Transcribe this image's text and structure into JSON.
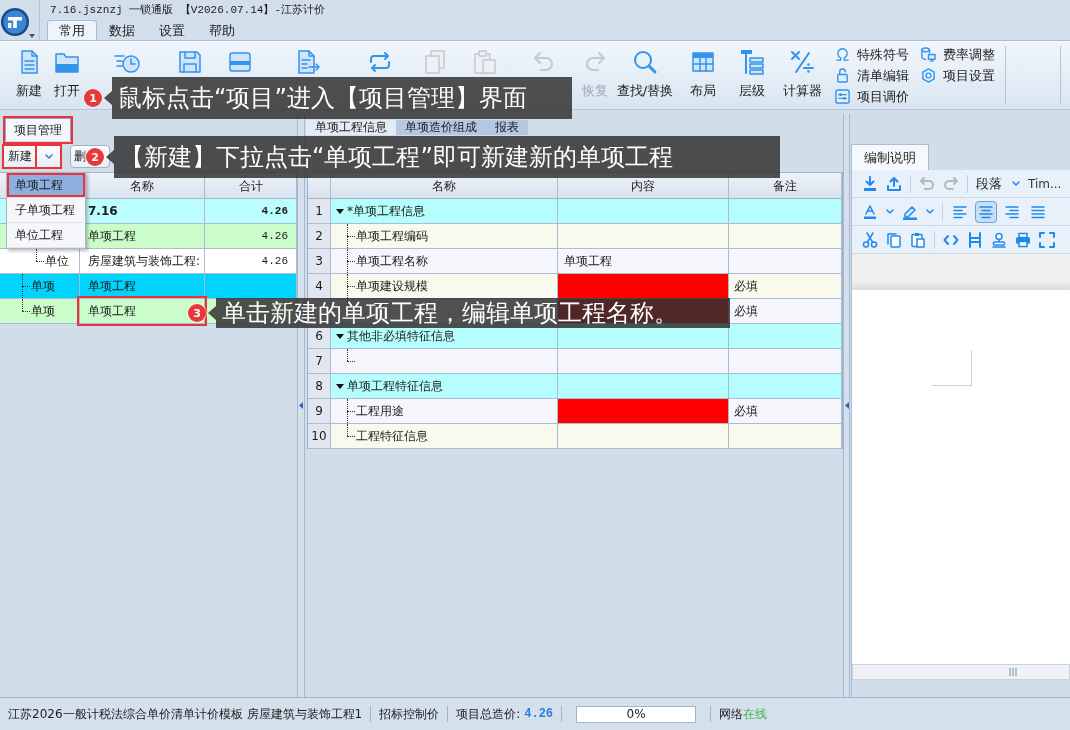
{
  "window": {
    "title": "7.16.jsznzj 一锁通版 【V2026.07.14】-江苏计价"
  },
  "menu_tabs": [
    {
      "label": "常用",
      "selected": true
    },
    {
      "label": "数据",
      "selected": false
    },
    {
      "label": "设置",
      "selected": false
    },
    {
      "label": "帮助",
      "selected": false
    }
  ],
  "ribbon": {
    "buttons": [
      {
        "label": "新建",
        "disabled": false
      },
      {
        "label": "打开",
        "disabled": false
      },
      {
        "disabled": false
      },
      {
        "disabled": false
      },
      {
        "disabled": false
      },
      {
        "disabled": false
      },
      {
        "disabled": false
      },
      {
        "disabled": true
      },
      {
        "disabled": true
      },
      {
        "disabled": true
      },
      {
        "label": "恢复",
        "disabled": true
      },
      {
        "label": "查找/替换",
        "disabled": false
      },
      {
        "label": "布局",
        "disabled": false
      },
      {
        "label": "层级",
        "disabled": false
      },
      {
        "label": "计算器",
        "disabled": false
      }
    ],
    "small_buttons": [
      {
        "label": "特殊符号"
      },
      {
        "label": "清单编辑"
      },
      {
        "label": "项目调价"
      },
      {
        "label": "费率调整"
      },
      {
        "label": "项目设置"
      }
    ]
  },
  "project_panel": {
    "tab": {
      "label": "项目管理",
      "highlighted": true
    },
    "toolbar": {
      "new_button": {
        "label": "新建",
        "highlighted": true
      },
      "new_dropdown": {
        "highlighted": true
      },
      "buttons": [
        {
          "label": "删"
        }
      ]
    },
    "new_menu": [
      {
        "label": "单项工程",
        "selected": true,
        "highlighted": true
      },
      {
        "label": "子单项工程",
        "selected": false,
        "highlighted": false
      },
      {
        "label": "单位工程",
        "selected": false,
        "highlighted": false
      }
    ],
    "tree": {
      "columns": [
        "名称",
        "合计"
      ],
      "rows": [
        {
          "name": "7.16",
          "total": "4.26",
          "kind": "project",
          "selected": false,
          "highlighted": false,
          "children": [
            {
              "name": "单项工程",
              "total": "4.26",
              "kind": "single",
              "selected": false,
              "highlighted": false,
              "children": [
                {
                  "level": "单位",
                  "name": "房屋建筑与装饰工程:",
                  "total": "4.26",
                  "kind": "unit",
                  "selected": false,
                  "highlighted": false
                }
              ]
            },
            {
              "level": "单项",
              "name": "单项工程",
              "kind": "single",
              "selected": true,
              "highlighted": false
            },
            {
              "level": "单项",
              "name": "单项工程",
              "kind": "single",
              "selected": false,
              "highlighted": true
            }
          ]
        }
      ]
    }
  },
  "info_panel": {
    "tabs": [
      {
        "label": "单项工程信息",
        "selected": true
      },
      {
        "label": "单项造价组成",
        "selected": false
      },
      {
        "label": "报表",
        "selected": false
      }
    ],
    "table": {
      "columns": [
        "名称",
        "内容",
        "备注"
      ],
      "rows": [
        {
          "number": "1",
          "name": "*单项工程信息",
          "expanded": true,
          "children": [
            {
              "number": "2",
              "name": "单项工程编码",
              "missing": false
            },
            {
              "number": "3",
              "name": "单项工程名称",
              "content": "单项工程",
              "missing": false
            },
            {
              "number": "4",
              "name": "单项建设规模",
              "missing": true,
              "remark": "必填"
            },
            {
              "missing": true,
              "remark": "必填"
            }
          ]
        },
        {
          "number": "6",
          "name": "其他非必填特征信息",
          "expanded": true,
          "children": [
            {
              "number": "7",
              "missing": false
            }
          ]
        },
        {
          "number": "8",
          "name": "单项工程特征信息",
          "expanded": true,
          "children": [
            {
              "number": "9",
              "name": "工程用途",
              "missing": true,
              "remark": "必填"
            },
            {
              "number": "10",
              "name": "工程特征信息",
              "missing": false
            }
          ]
        }
      ]
    }
  },
  "notes_panel": {
    "tab": {
      "label": "编制说明",
      "selected": true
    },
    "paragraph_style": "段落",
    "font": "Tim...",
    "alignment_buttons": [
      {
        "selected": false
      },
      {
        "selected": true
      },
      {
        "selected": false
      },
      {
        "selected": false
      }
    ]
  },
  "status_bar": {
    "template": "江苏2026一般计税法综合单价清单计价模板",
    "project": "房屋建筑与装饰工程1",
    "price_type": "招标控制价",
    "total_label": "项目总造价:",
    "total_value": "4.26",
    "progress": {
      "level": 0,
      "reading": "0%"
    },
    "network": {
      "label": "网络",
      "status": "在线",
      "online": true
    }
  },
  "callouts": [
    {
      "number": "1",
      "text": "鼠标点击“项目”进入【项目管理】界面"
    },
    {
      "number": "2",
      "text": "【新建】下拉点击“单项工程”即可新建新的单项工程"
    },
    {
      "number": "3",
      "text": "单击新建的单项工程，编辑单项工程名称。"
    }
  ]
}
